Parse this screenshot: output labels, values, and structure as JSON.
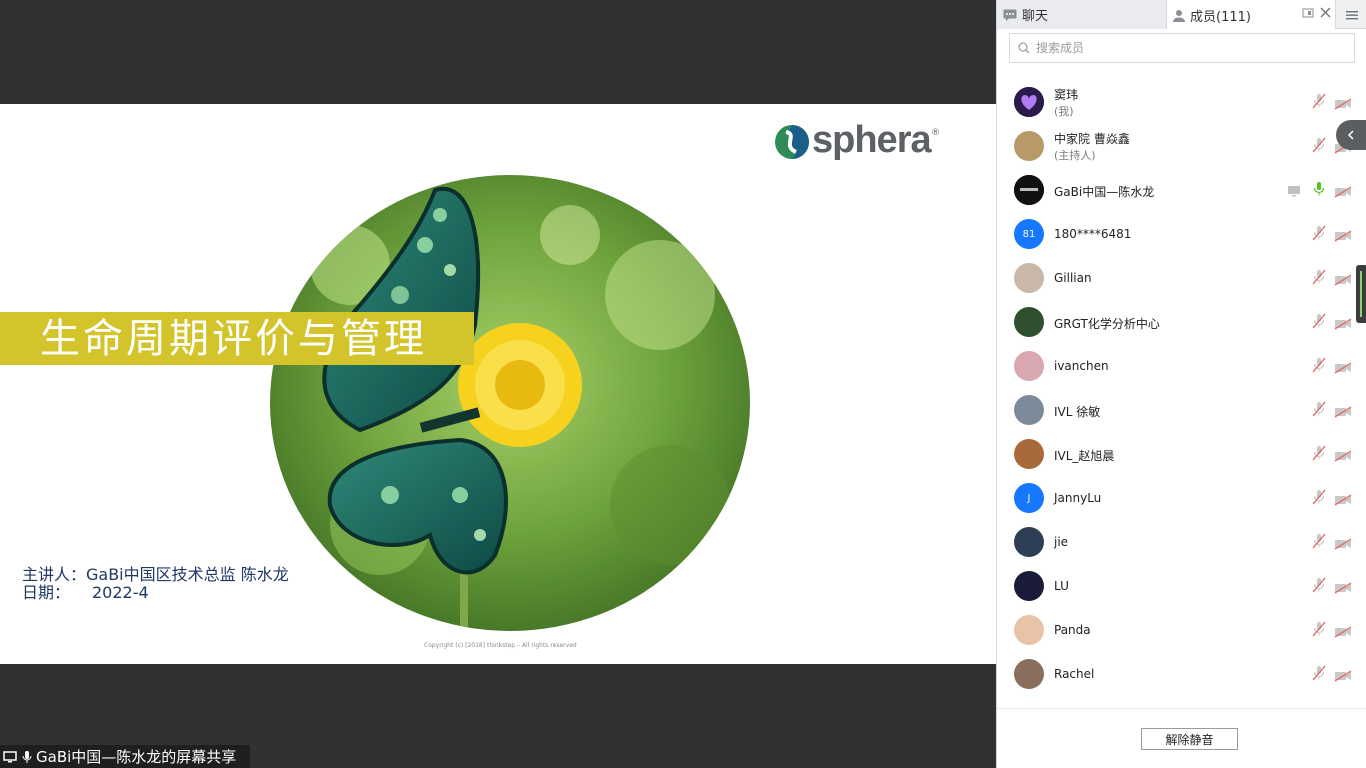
{
  "slide": {
    "title": "生命周期评价与管理",
    "logo_text": "sphera",
    "logo_mark": "®",
    "presenter": "主讲人：GaBi中国区技术总监 陈水龙",
    "date_label": "日期：",
    "date_value": "2022-4",
    "copyright": "Copyright (c) [2018] thinkstep – All rights reserved",
    "brand_color": "#d4c42c"
  },
  "share_status": {
    "text": "GaBi中国—陈水龙的屏幕共享"
  },
  "panel": {
    "tabs": {
      "chat": "聊天",
      "members": "成员(111)"
    },
    "search_placeholder": "搜索成员",
    "members": [
      {
        "name": "窦玮",
        "sub": "(我)",
        "avatar": "heart",
        "mic": "muted",
        "cam": "off"
      },
      {
        "name": "中家院 曹焱鑫",
        "sub": "(主持人)",
        "avatar": "photo",
        "mic": "muted",
        "cam": "off"
      },
      {
        "name": "GaBi中国—陈水龙",
        "sub": "",
        "avatar": "logo-black",
        "mic": "active",
        "cam": "off",
        "sharing": true
      },
      {
        "name": "180****6481",
        "sub": "",
        "avatar": "initials",
        "initials": "81",
        "mic": "muted",
        "cam": "off"
      },
      {
        "name": "Gillian",
        "sub": "",
        "avatar": "photo",
        "mic": "muted",
        "cam": "off"
      },
      {
        "name": "GRGT化学分析中心",
        "sub": "",
        "avatar": "photo",
        "mic": "muted",
        "cam": "off"
      },
      {
        "name": "ivanchen",
        "sub": "",
        "avatar": "photo",
        "mic": "muted",
        "cam": "off"
      },
      {
        "name": "IVL 徐敏",
        "sub": "",
        "avatar": "photo",
        "mic": "muted",
        "cam": "off"
      },
      {
        "name": "IVL_赵旭晨",
        "sub": "",
        "avatar": "photo",
        "mic": "muted",
        "cam": "off"
      },
      {
        "name": "JannyLu",
        "sub": "",
        "avatar": "initials",
        "initials": "J",
        "mic": "muted",
        "cam": "off"
      },
      {
        "name": "jie",
        "sub": "",
        "avatar": "photo",
        "mic": "muted",
        "cam": "off"
      },
      {
        "name": "LU",
        "sub": "",
        "avatar": "photo",
        "mic": "muted",
        "cam": "off"
      },
      {
        "name": "Panda",
        "sub": "",
        "avatar": "photo",
        "mic": "muted",
        "cam": "off"
      },
      {
        "name": "Rachel",
        "sub": "",
        "avatar": "photo",
        "mic": "muted",
        "cam": "off"
      }
    ],
    "unmute_all_label": "解除静音"
  }
}
